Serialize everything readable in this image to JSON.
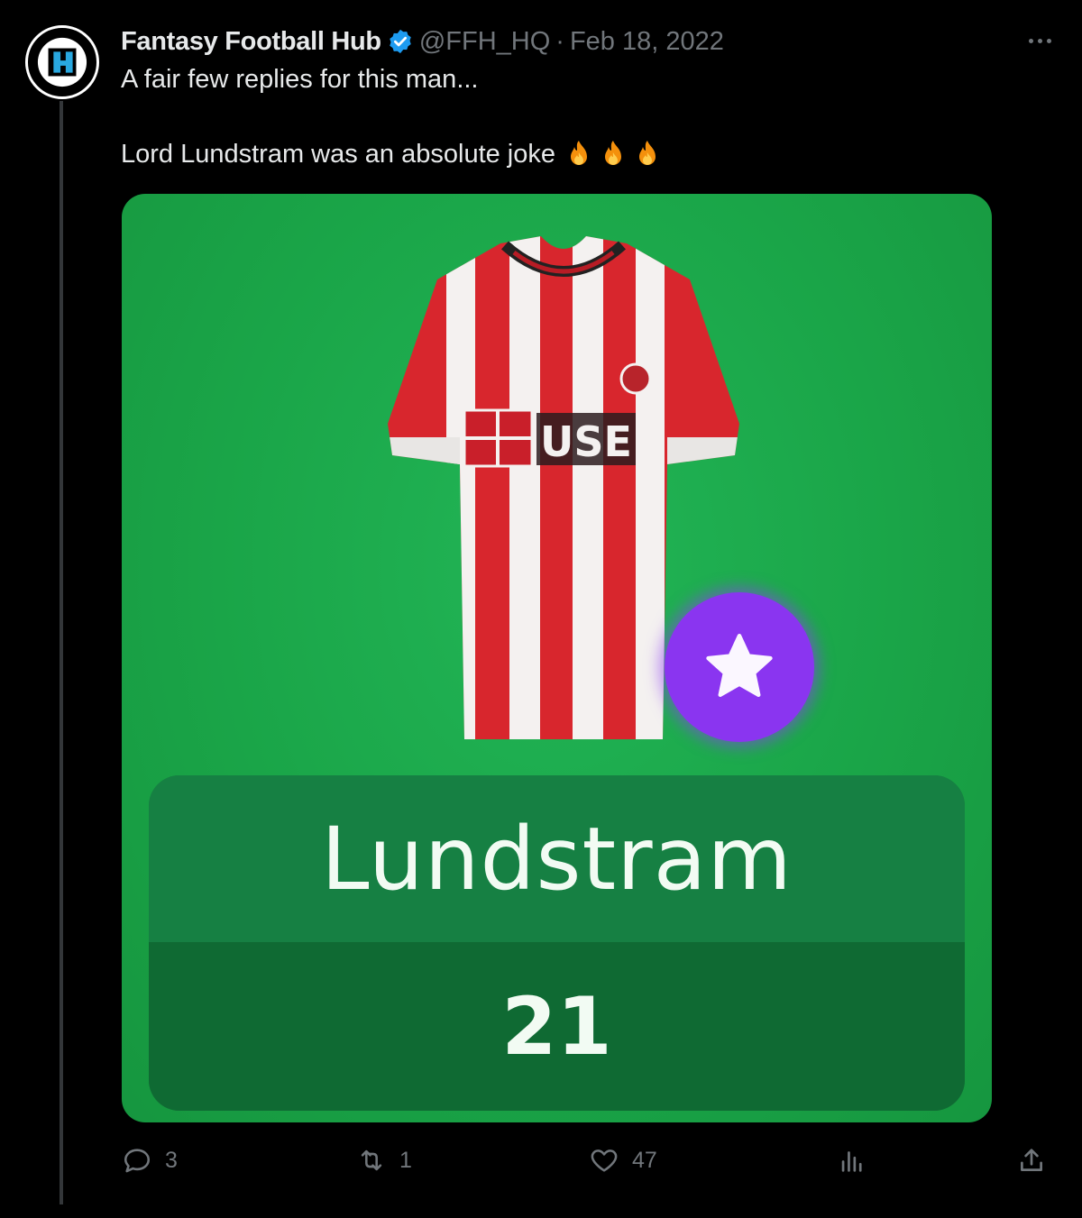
{
  "tweet": {
    "author_name": "Fantasy Football Hub",
    "handle": "@FFH_HQ",
    "separator": "·",
    "date": "Feb 18, 2022",
    "text_line1": "A fair few replies for this man...",
    "text_line2": "Lord Lundstram was an absolute joke",
    "emoji": [
      "fire",
      "fire",
      "fire"
    ]
  },
  "media": {
    "player_name": "Lundstram",
    "points": "21",
    "badge_icon": "star-icon",
    "shirt": "red-white-striped-kit"
  },
  "actions": {
    "replies": "3",
    "reposts": "1",
    "likes": "47"
  },
  "colors": {
    "background": "#000000",
    "pitch_green": "#1ca94b",
    "captain_purple": "#8a35f0",
    "verified_blue": "#1d9bf0",
    "muted": "#71767b"
  }
}
